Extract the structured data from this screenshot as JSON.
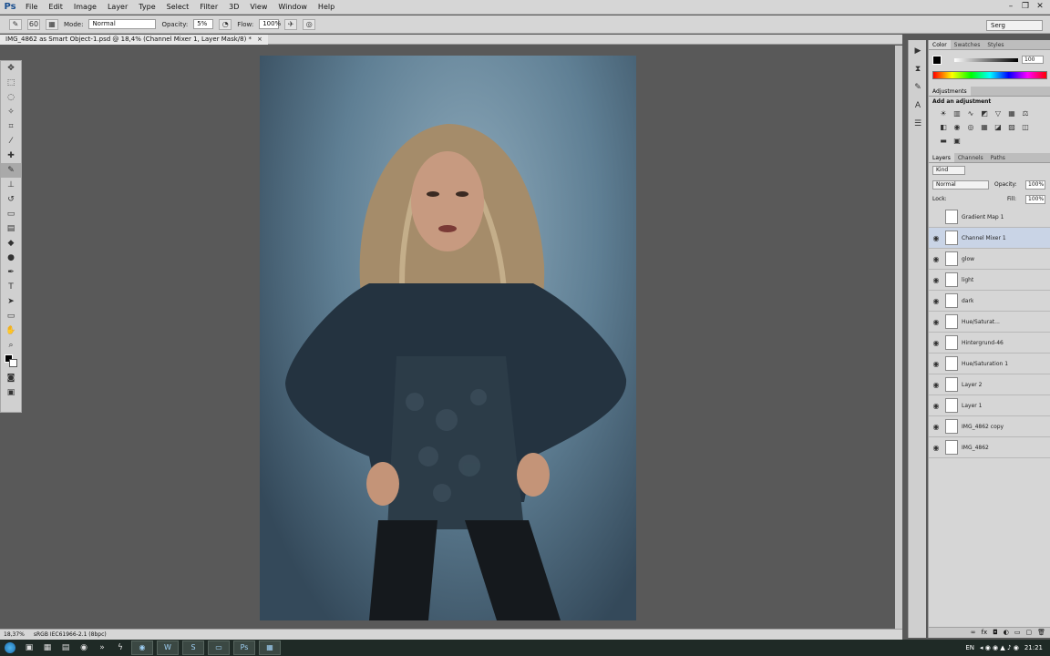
{
  "app": {
    "logo": "Ps"
  },
  "menu": [
    "File",
    "Edit",
    "Image",
    "Layer",
    "Type",
    "Select",
    "Filter",
    "3D",
    "View",
    "Window",
    "Help"
  ],
  "workspace": "Serg",
  "options": {
    "brush_size": "60",
    "mode_label": "Mode:",
    "mode_value": "Normal",
    "opacity_label": "Opacity:",
    "opacity_value": "5%",
    "flow_label": "Flow:",
    "flow_value": "100%"
  },
  "document": {
    "tab_title": "IMG_4862 as Smart Object-1.psd @ 18,4% (Channel Mixer 1, Layer Mask/8) *",
    "close": "×"
  },
  "status": {
    "zoom": "18,37%",
    "profile": "sRGB IEC61966-2.1 (8bpc)"
  },
  "panels": {
    "color_tabs": [
      "Color",
      "Swatches",
      "Styles"
    ],
    "color_value": "100",
    "adjustments_tab": "Adjustments",
    "adjustments_hint": "Add an adjustment",
    "layers_tabs": [
      "Layers",
      "Channels",
      "Paths"
    ],
    "filter_kind": "Kind",
    "blend_mode": "Normal",
    "opacity_label": "Opacity:",
    "opacity_value": "100%",
    "lock_label": "Lock:",
    "fill_label": "Fill:",
    "fill_value": "100%"
  },
  "layers": [
    {
      "name": "Gradient Map 1",
      "visible": false
    },
    {
      "name": "Channel Mixer 1",
      "visible": true,
      "selected": true
    },
    {
      "name": "glow",
      "visible": true
    },
    {
      "name": "light",
      "visible": true
    },
    {
      "name": "dark",
      "visible": true
    },
    {
      "name": "Hue/Saturat...",
      "visible": true
    },
    {
      "name": "Hintergrund-46",
      "visible": true
    },
    {
      "name": "Hue/Saturation 1",
      "visible": true
    },
    {
      "name": "Layer 2",
      "visible": true
    },
    {
      "name": "Layer 1",
      "visible": true
    },
    {
      "name": "IMG_4862 copy",
      "visible": true
    },
    {
      "name": "IMG_4862",
      "visible": true
    }
  ],
  "taskbar": {
    "lang": "EN",
    "time": "21:21"
  }
}
